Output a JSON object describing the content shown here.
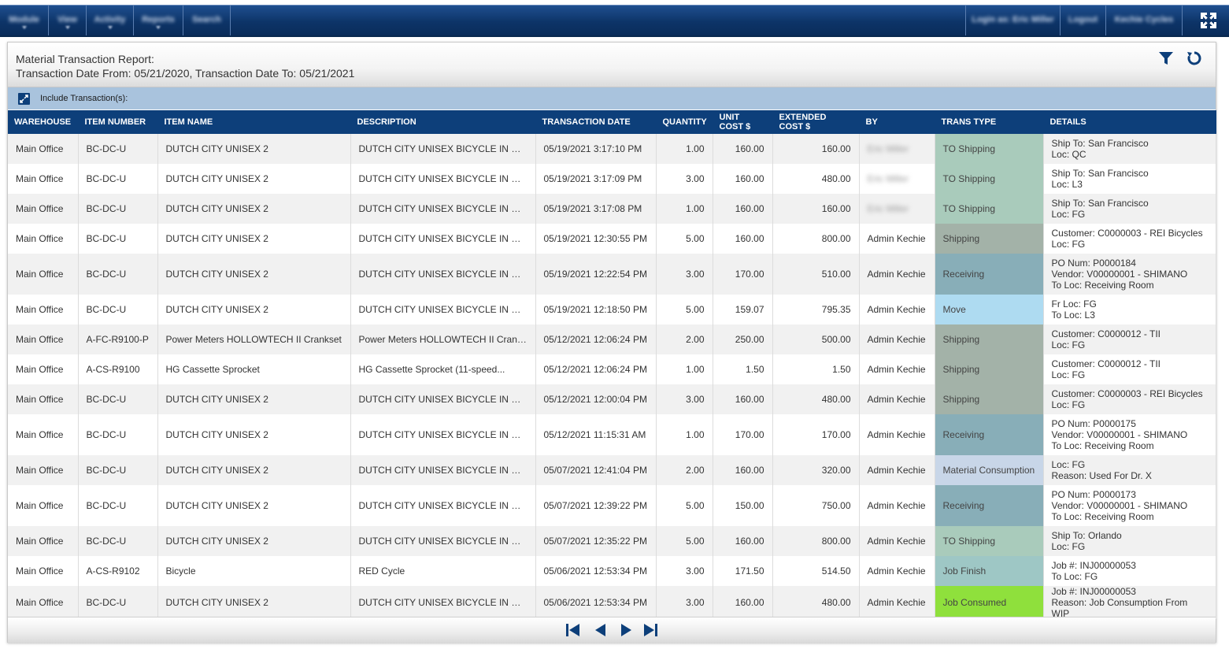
{
  "nav": {
    "left": [
      {
        "label": "Module"
      },
      {
        "label": "View"
      },
      {
        "label": "Activity"
      },
      {
        "label": "Reports"
      },
      {
        "label": "Search"
      }
    ],
    "right": [
      {
        "label": "Login as: Eric Miller"
      },
      {
        "label": "Logout"
      },
      {
        "label": "Kechie Cycles"
      }
    ]
  },
  "report": {
    "title": "Material Transaction Report:",
    "range": "Transaction Date From: 05/21/2020, Transaction Date To: 05/21/2021"
  },
  "include_bar": {
    "label": "Include Transaction(s):"
  },
  "columns": [
    "WAREHOUSE",
    "ITEM NUMBER",
    "ITEM NAME",
    "DESCRIPTION",
    "TRANSACTION DATE",
    "QUANTITY",
    "UNIT COST $",
    "EXTENDED COST $",
    "BY",
    "TRANS TYPE",
    "DETAILS"
  ],
  "rows": [
    {
      "warehouse": "Main Office",
      "item_number": "BC-DC-U",
      "item_name": "DUTCH CITY UNISEX 2",
      "description": "DUTCH CITY UNISEX BICYCLE IN MATTE BLACK",
      "date": "05/19/2021 3:17:10 PM",
      "quantity": "1.00",
      "unit_cost": "160.00",
      "extended_cost": "160.00",
      "by": "Eric Miller",
      "trans_type": "TO Shipping",
      "details": [
        "Ship To: San Francisco",
        "Loc: QC"
      ]
    },
    {
      "warehouse": "Main Office",
      "item_number": "BC-DC-U",
      "item_name": "DUTCH CITY UNISEX 2",
      "description": "DUTCH CITY UNISEX BICYCLE IN MATTE BLACK",
      "date": "05/19/2021 3:17:09 PM",
      "quantity": "3.00",
      "unit_cost": "160.00",
      "extended_cost": "480.00",
      "by": "Eric Miller",
      "trans_type": "TO Shipping",
      "details": [
        "Ship To: San Francisco",
        "Loc: L3"
      ]
    },
    {
      "warehouse": "Main Office",
      "item_number": "BC-DC-U",
      "item_name": "DUTCH CITY UNISEX 2",
      "description": "DUTCH CITY UNISEX BICYCLE IN MATTE BLACK",
      "date": "05/19/2021 3:17:08 PM",
      "quantity": "1.00",
      "unit_cost": "160.00",
      "extended_cost": "160.00",
      "by": "Eric Miller",
      "trans_type": "TO Shipping",
      "details": [
        "Ship To: San Francisco",
        "Loc: FG"
      ]
    },
    {
      "warehouse": "Main Office",
      "item_number": "BC-DC-U",
      "item_name": "DUTCH CITY UNISEX 2",
      "description": "DUTCH CITY UNISEX BICYCLE IN MATTE BLACK",
      "date": "05/19/2021 12:30:55 PM",
      "quantity": "5.00",
      "unit_cost": "160.00",
      "extended_cost": "800.00",
      "by": "Admin Kechie",
      "trans_type": "Shipping",
      "details": [
        "Customer: C0000003 - REI Bicycles",
        "Loc: FG"
      ]
    },
    {
      "warehouse": "Main Office",
      "item_number": "BC-DC-U",
      "item_name": "DUTCH CITY UNISEX 2",
      "description": "DUTCH CITY UNISEX BICYCLE IN MATTE BLACK",
      "date": "05/19/2021 12:22:54 PM",
      "quantity": "3.00",
      "unit_cost": "170.00",
      "extended_cost": "510.00",
      "by": "Admin Kechie",
      "trans_type": "Receiving",
      "details": [
        "PO Num: P0000184",
        "Vendor: V00000001 - SHIMANO",
        "To Loc: Receiving Room"
      ]
    },
    {
      "warehouse": "Main Office",
      "item_number": "BC-DC-U",
      "item_name": "DUTCH CITY UNISEX 2",
      "description": "DUTCH CITY UNISEX BICYCLE IN MATTE BLACK",
      "date": "05/19/2021 12:18:50 PM",
      "quantity": "5.00",
      "unit_cost": "159.07",
      "extended_cost": "795.35",
      "by": "Admin Kechie",
      "trans_type": "Move",
      "details": [
        "Fr Loc: FG",
        "To Loc: L3"
      ]
    },
    {
      "warehouse": "Main Office",
      "item_number": "A-FC-R9100-P",
      "item_name": "Power Meters HOLLOWTECH II Crankset",
      "description": "Power Meters HOLLOWTECH II Crankset",
      "date": "05/12/2021 12:06:24 PM",
      "quantity": "2.00",
      "unit_cost": "250.00",
      "extended_cost": "500.00",
      "by": "Admin Kechie",
      "trans_type": "Shipping",
      "details": [
        "Customer: C0000012 - TII",
        "Loc: FG"
      ]
    },
    {
      "warehouse": "Main Office",
      "item_number": "A-CS-R9100",
      "item_name": "HG Cassette Sprocket",
      "description": "HG Cassette Sprocket (11-speed...",
      "date": "05/12/2021 12:06:24 PM",
      "quantity": "1.00",
      "unit_cost": "1.50",
      "extended_cost": "1.50",
      "by": "Admin Kechie",
      "trans_type": "Shipping",
      "details": [
        "Customer: C0000012 - TII",
        "Loc: FG"
      ]
    },
    {
      "warehouse": "Main Office",
      "item_number": "BC-DC-U",
      "item_name": "DUTCH CITY UNISEX 2",
      "description": "DUTCH CITY UNISEX BICYCLE IN MATTE BLACK",
      "date": "05/12/2021 12:00:04 PM",
      "quantity": "3.00",
      "unit_cost": "160.00",
      "extended_cost": "480.00",
      "by": "Admin Kechie",
      "trans_type": "Shipping",
      "details": [
        "Customer: C0000003 - REI Bicycles",
        "Loc: FG"
      ]
    },
    {
      "warehouse": "Main Office",
      "item_number": "BC-DC-U",
      "item_name": "DUTCH CITY UNISEX 2",
      "description": "DUTCH CITY UNISEX BICYCLE IN MATTE BLACK",
      "date": "05/12/2021 11:15:31 AM",
      "quantity": "1.00",
      "unit_cost": "170.00",
      "extended_cost": "170.00",
      "by": "Admin Kechie",
      "trans_type": "Receiving",
      "details": [
        "PO Num: P0000175",
        "Vendor: V00000001 - SHIMANO",
        "To Loc: Receiving Room"
      ]
    },
    {
      "warehouse": "Main Office",
      "item_number": "BC-DC-U",
      "item_name": "DUTCH CITY UNISEX 2",
      "description": "DUTCH CITY UNISEX BICYCLE IN MATTE BLACK",
      "date": "05/07/2021 12:41:04 PM",
      "quantity": "2.00",
      "unit_cost": "160.00",
      "extended_cost": "320.00",
      "by": "Admin Kechie",
      "trans_type": "Material Consumption",
      "details": [
        "Loc: FG",
        "Reason: Used For Dr. X"
      ]
    },
    {
      "warehouse": "Main Office",
      "item_number": "BC-DC-U",
      "item_name": "DUTCH CITY UNISEX 2",
      "description": "DUTCH CITY UNISEX BICYCLE IN MATTE BLACK",
      "date": "05/07/2021 12:39:22 PM",
      "quantity": "5.00",
      "unit_cost": "150.00",
      "extended_cost": "750.00",
      "by": "Admin Kechie",
      "trans_type": "Receiving",
      "details": [
        "PO Num: P0000173",
        "Vendor: V00000001 - SHIMANO",
        "To Loc: Receiving Room"
      ]
    },
    {
      "warehouse": "Main Office",
      "item_number": "BC-DC-U",
      "item_name": "DUTCH CITY UNISEX 2",
      "description": "DUTCH CITY UNISEX BICYCLE IN MATTE BLACK",
      "date": "05/07/2021 12:35:22 PM",
      "quantity": "5.00",
      "unit_cost": "160.00",
      "extended_cost": "800.00",
      "by": "Admin Kechie",
      "trans_type": "TO Shipping",
      "details": [
        "Ship To: Orlando",
        "Loc: FG"
      ]
    },
    {
      "warehouse": "Main Office",
      "item_number": "A-CS-R9102",
      "item_name": "Bicycle",
      "description": "RED Cycle",
      "date": "05/06/2021 12:53:34 PM",
      "quantity": "3.00",
      "unit_cost": "171.50",
      "extended_cost": "514.50",
      "by": "Admin Kechie",
      "trans_type": "Job Finish",
      "details": [
        "Job #: INJ00000053",
        "To Loc: FG"
      ]
    },
    {
      "warehouse": "Main Office",
      "item_number": "BC-DC-U",
      "item_name": "DUTCH CITY UNISEX 2",
      "description": "DUTCH CITY UNISEX BICYCLE IN MATTE BLACK",
      "date": "05/06/2021 12:53:34 PM",
      "quantity": "3.00",
      "unit_cost": "160.00",
      "extended_cost": "480.00",
      "by": "Admin Kechie",
      "trans_type": "Job Consumed",
      "details": [
        "Job #: INJ00000053",
        "Reason: Job Consumption From WIP"
      ]
    }
  ],
  "trans_type_colors": {
    "TO Shipping": "#a9cbbb",
    "Shipping": "#a3b2a8",
    "Receiving": "#88aeb8",
    "Move": "#aedbf1",
    "Material Consumption": "#c8d6e8",
    "Job Finish": "#9ec7c5",
    "Job Consumed": "#8fe03c"
  },
  "pager": {
    "icons": [
      "first-page-icon",
      "prev-page-icon",
      "next-page-icon",
      "last-page-icon"
    ]
  }
}
